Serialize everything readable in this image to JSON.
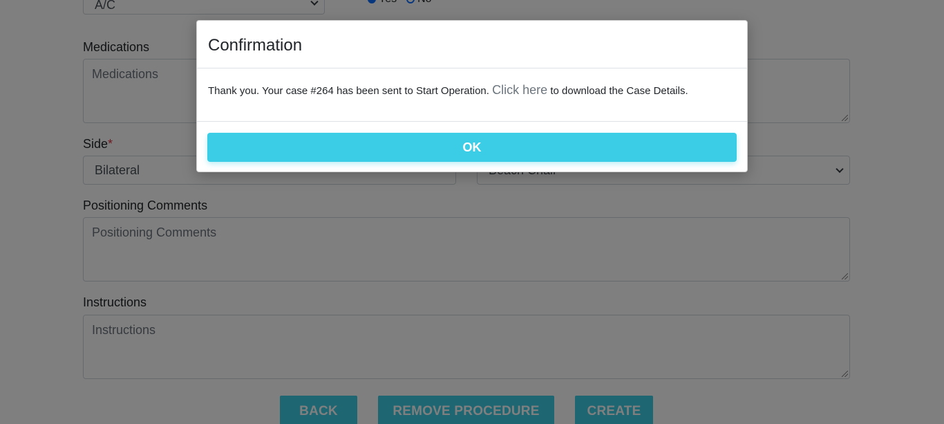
{
  "form": {
    "anesthesia_select": {
      "value": "A/C"
    },
    "radio_options": [
      "Yes",
      "No"
    ],
    "medications": {
      "label": "Medications",
      "placeholder": "Medications"
    },
    "side": {
      "label": "Side",
      "required_mark": "*",
      "value": "Bilateral"
    },
    "position_select": {
      "value": "Beach Chair"
    },
    "positioning_comments": {
      "label": "Positioning Comments",
      "placeholder": "Positioning Comments"
    },
    "instructions": {
      "label": "Instructions",
      "placeholder": "Instructions"
    },
    "buttons": {
      "back": "BACK",
      "remove_procedure": "REMOVE PROCEDURE",
      "create": "CREATE"
    }
  },
  "modal": {
    "title": "Confirmation",
    "message_before": "Thank you. Your case #264 has been sent to Start Operation.",
    "link_text": "Click here",
    "message_after": "to download the Case Details.",
    "ok_label": "OK"
  },
  "colors": {
    "accent": "#3bcde5",
    "required": "#dc3545",
    "link": "#6c757d"
  }
}
